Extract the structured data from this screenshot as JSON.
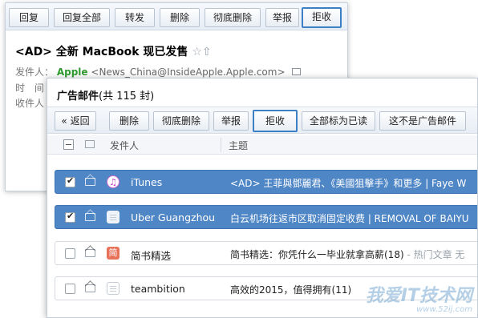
{
  "back_window": {
    "toolbar": {
      "reply": "回复",
      "reply_all": "回复全部",
      "forward": "转发",
      "delete": "删除",
      "delete_permanent": "彻底删除",
      "report": "举报",
      "reject": "拒收"
    },
    "subject": "<AD> 全新 MacBook 现已发售",
    "star_icon": "☆",
    "flag_icon": "⇧",
    "from_label": "发件人：",
    "from_name": "Apple",
    "from_address": "<News_China@InsideApple.Apple.com>",
    "time_label": "时　间",
    "to_label": "收件人"
  },
  "front_window": {
    "folder_title": "广告邮件",
    "folder_count": "(共 115 封)",
    "toolbar": {
      "back": "« 返回",
      "delete": "删除",
      "delete_permanent": "彻底删除",
      "report": "举报",
      "reject": "拒收",
      "mark_all_read": "全部标为已读",
      "not_ad": "这不是广告邮件"
    },
    "columns": {
      "sender": "发件人",
      "subject": "主题"
    },
    "rows": [
      {
        "checked": true,
        "selected": true,
        "icon": "itunes-icon",
        "icon_glyph": "♫",
        "sender": "iTunes",
        "subject": "<AD> 王菲與鄧麗君、《美國狙擊手》和更多 | Faye W",
        "preview": ""
      },
      {
        "checked": true,
        "selected": true,
        "icon": "doc-icon",
        "icon_glyph": "",
        "sender": "Uber Guangzhou",
        "subject": "白云机场往返市区取消固定收费 | REMOVAL OF BAIYU",
        "preview": ""
      },
      {
        "checked": false,
        "selected": false,
        "icon": "jianshu-icon",
        "icon_glyph": "简",
        "sender": "简书精选",
        "subject": "简书精选：你凭什么一毕业就拿高薪(18)",
        "preview": " - 热门文章 无"
      },
      {
        "checked": false,
        "selected": false,
        "icon": "doc-icon",
        "icon_glyph": "",
        "sender": "teambition",
        "subject": "高效的2015，值得拥有(11)",
        "preview": ""
      }
    ]
  },
  "watermark": {
    "text": "我爱IT技术网",
    "url": "www.52ij.com"
  },
  "colors": {
    "accent": "#3c7fc4",
    "selected_row": "#4f86c6",
    "sender_green": "#2e9a2e"
  }
}
